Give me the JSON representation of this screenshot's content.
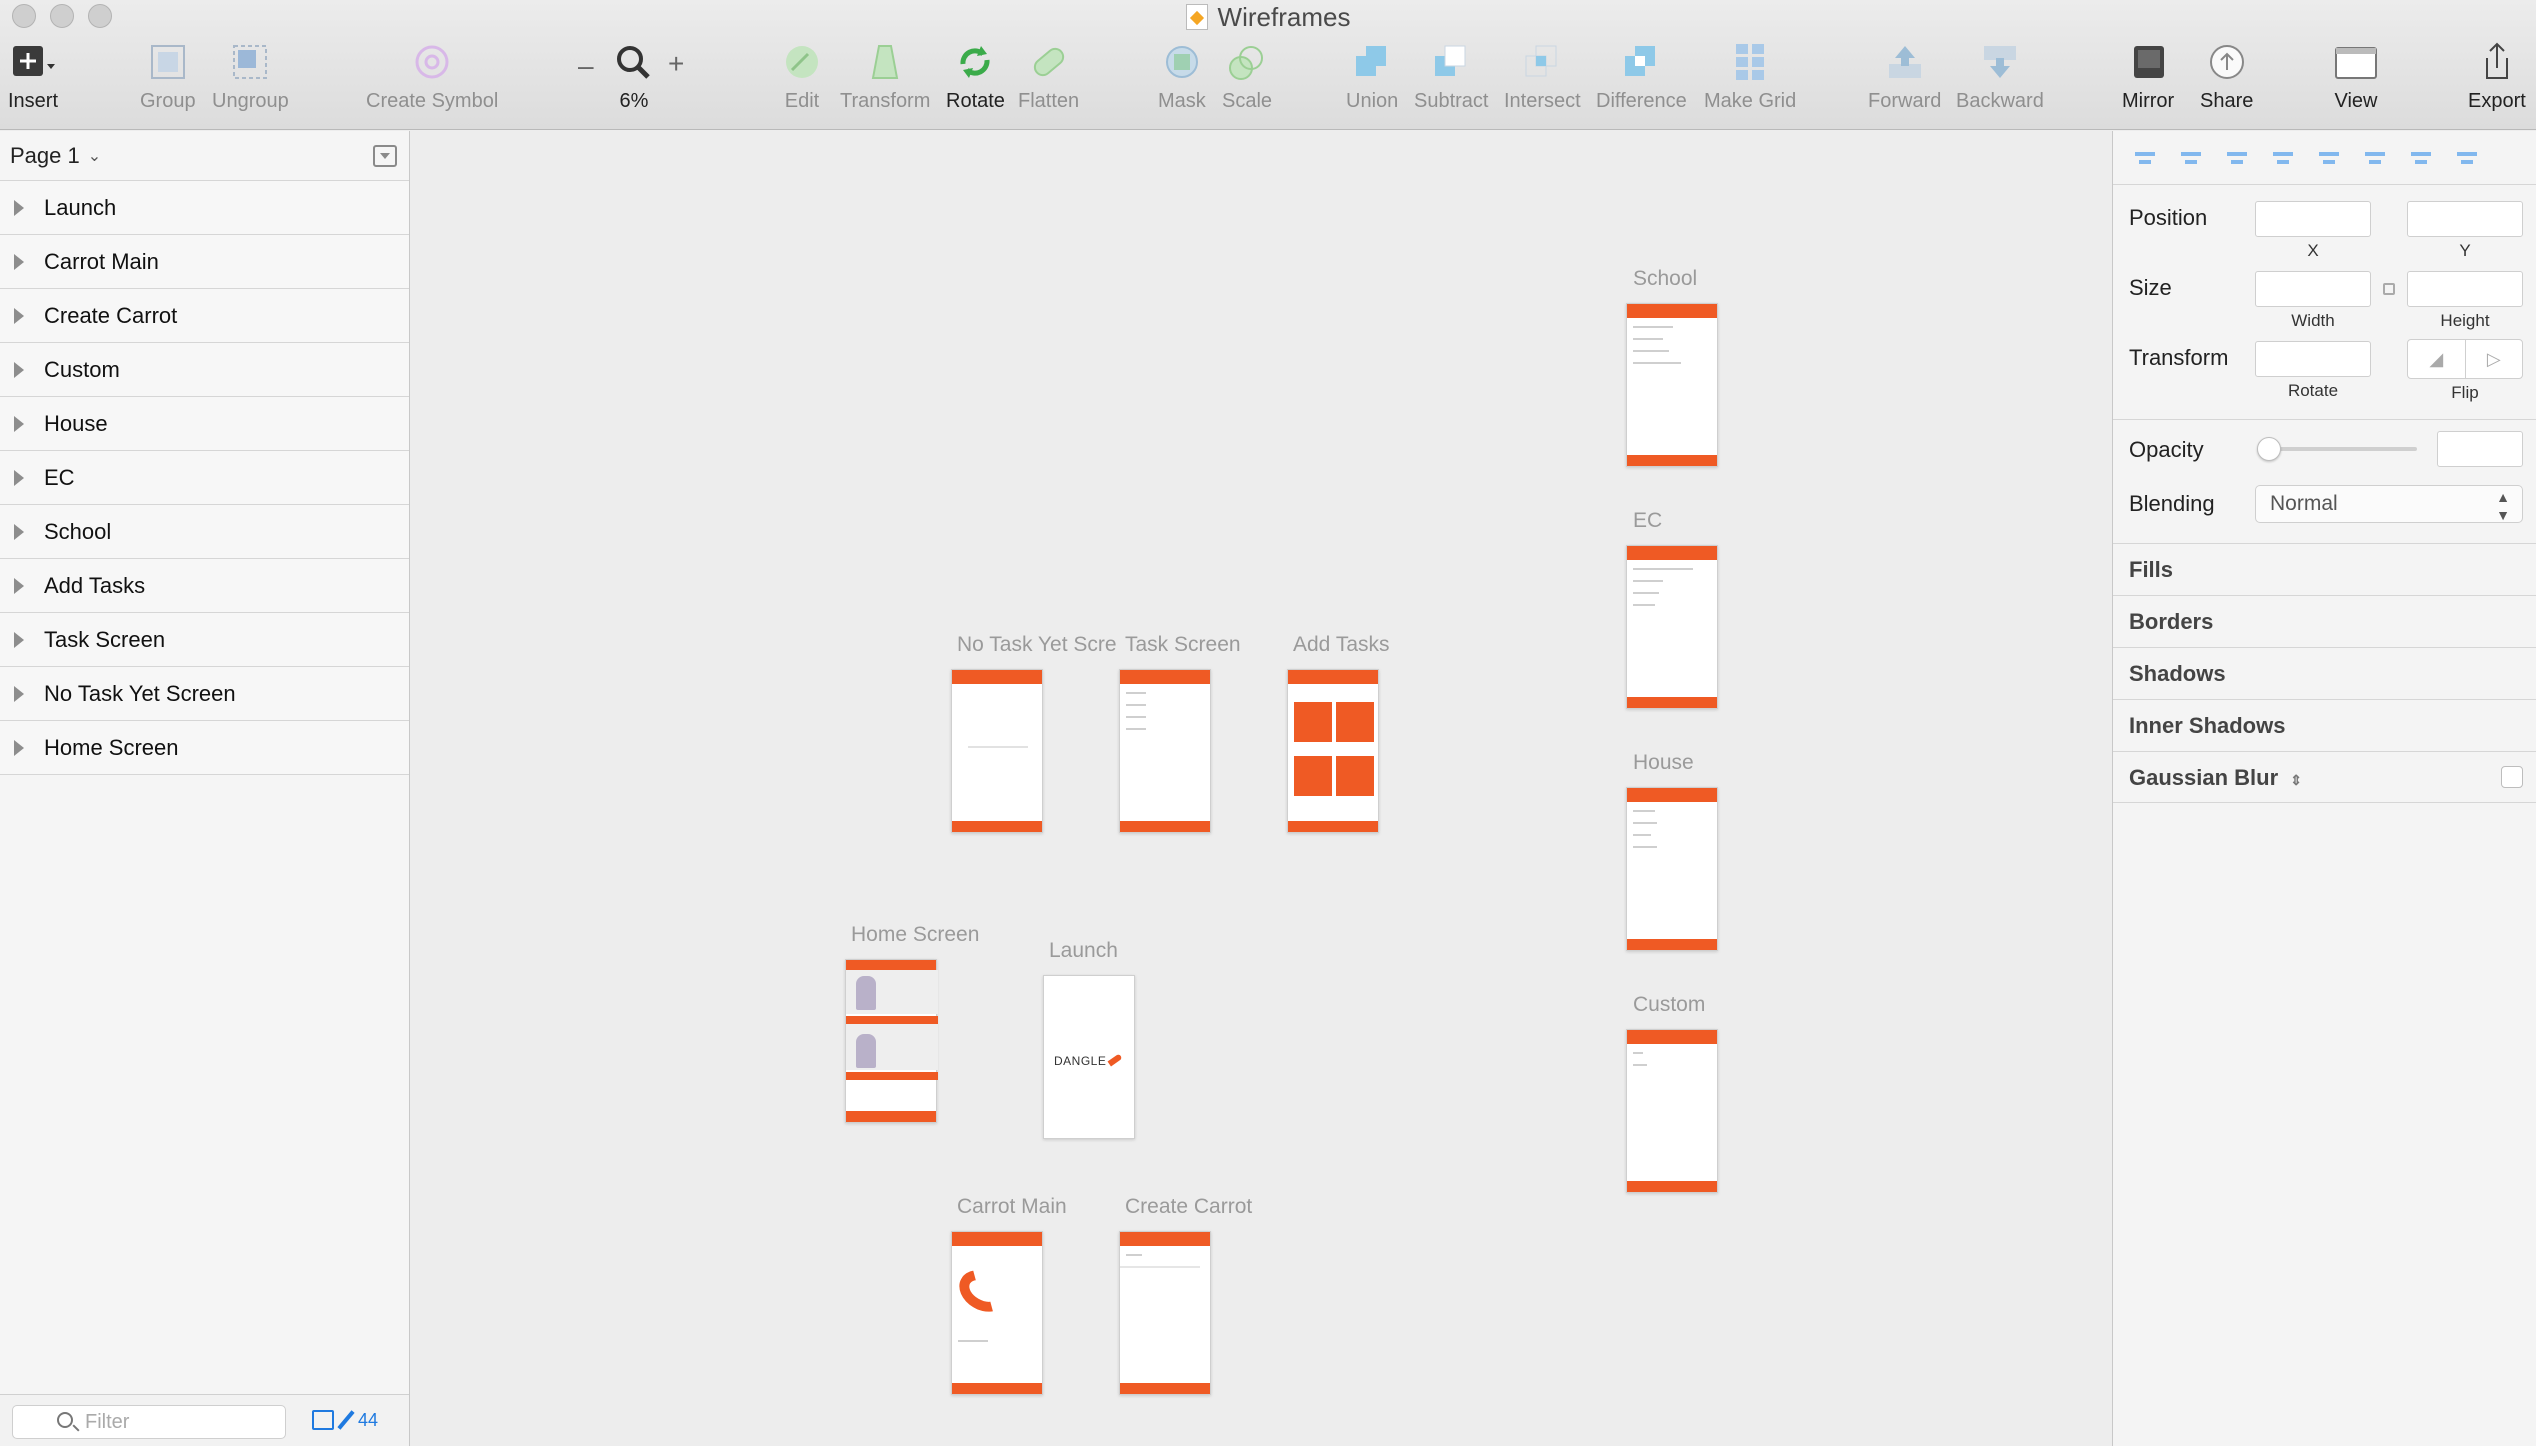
{
  "window": {
    "title": "Wireframes"
  },
  "toolbar": {
    "insert": "Insert",
    "group": "Group",
    "ungroup": "Ungroup",
    "create_symbol": "Create Symbol",
    "zoom_minus": "–",
    "zoom_plus": "+",
    "zoom_level": "6%",
    "edit": "Edit",
    "transform": "Transform",
    "rotate": "Rotate",
    "flatten": "Flatten",
    "mask": "Mask",
    "scale": "Scale",
    "union": "Union",
    "subtract": "Subtract",
    "intersect": "Intersect",
    "difference": "Difference",
    "make_grid": "Make Grid",
    "forward": "Forward",
    "backward": "Backward",
    "mirror": "Mirror",
    "share": "Share",
    "view": "View",
    "export": "Export"
  },
  "sidebar": {
    "page": "Page 1",
    "layers": [
      "Launch",
      "Carrot Main",
      "Create Carrot",
      "Custom",
      "House",
      "EC",
      "School",
      "Add Tasks",
      "Task Screen",
      "No Task Yet Screen",
      "Home Screen"
    ],
    "filter_placeholder": "Filter",
    "count": "44"
  },
  "canvas": {
    "artboards": {
      "school": "School",
      "ec": "EC",
      "house": "House",
      "custom": "Custom",
      "no_task": "No Task Yet Scre",
      "task_screen": "Task Screen",
      "add_tasks": "Add Tasks",
      "home_screen": "Home Screen",
      "launch": "Launch",
      "carrot_main": "Carrot Main",
      "create_carrot": "Create Carrot"
    },
    "launch_logo": "DANGLE"
  },
  "inspector": {
    "position": "Position",
    "x": "X",
    "y": "Y",
    "size": "Size",
    "width": "Width",
    "height": "Height",
    "transform": "Transform",
    "rotate": "Rotate",
    "flip": "Flip",
    "opacity": "Opacity",
    "blending": "Blending",
    "blending_value": "Normal",
    "fills": "Fills",
    "borders": "Borders",
    "shadows": "Shadows",
    "inner_shadows": "Inner Shadows",
    "gaussian_blur": "Gaussian Blur"
  },
  "colors": {
    "accent": "#ef5a24",
    "align_blue": "#82b8ee",
    "link_blue": "#1f7ae0"
  }
}
